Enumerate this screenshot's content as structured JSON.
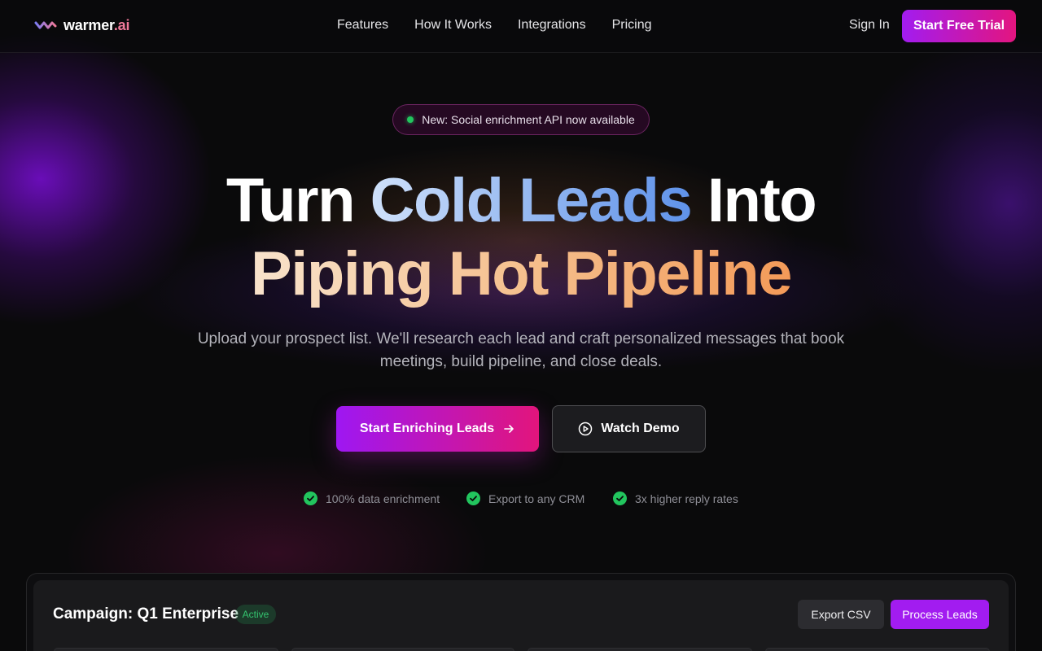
{
  "header": {
    "logo": {
      "name": "warmer",
      "suffix": ".ai"
    },
    "nav": [
      "Features",
      "How It Works",
      "Integrations",
      "Pricing"
    ],
    "sign_in": "Sign In",
    "cta": "Start Free Trial"
  },
  "hero": {
    "announcement": "New: Social enrichment API now available",
    "headline_line1": {
      "part1": "Turn",
      "highlight": "Cold Leads",
      "part2": "Into"
    },
    "headline_line2": {
      "highlight": "Piping Hot Pipeline"
    },
    "subtitle": "Upload your prospect list. We'll research each lead and craft personalized messages that book meetings, build pipeline, and close deals.",
    "primary_cta": "Start Enriching Leads",
    "secondary_cta": "Watch Demo",
    "trust_points": [
      "100% data enrichment",
      "Export to any CRM",
      "3x higher reply rates"
    ]
  },
  "dashboard": {
    "campaign_title": "Campaign: Q1 Enterprise",
    "status": "Active",
    "export_label": "Export CSV",
    "process_label": "Process Leads"
  },
  "colors": {
    "accent_purple": "#a21cf0",
    "accent_pink": "#e3157f",
    "cold_blue": "#8fb4f0",
    "hot_orange": "#f5c08e",
    "success_green": "#22c55e"
  },
  "icons": [
    "wave-logo-icon",
    "arrow-right-icon",
    "play-circle-icon",
    "check-circle-icon"
  ]
}
